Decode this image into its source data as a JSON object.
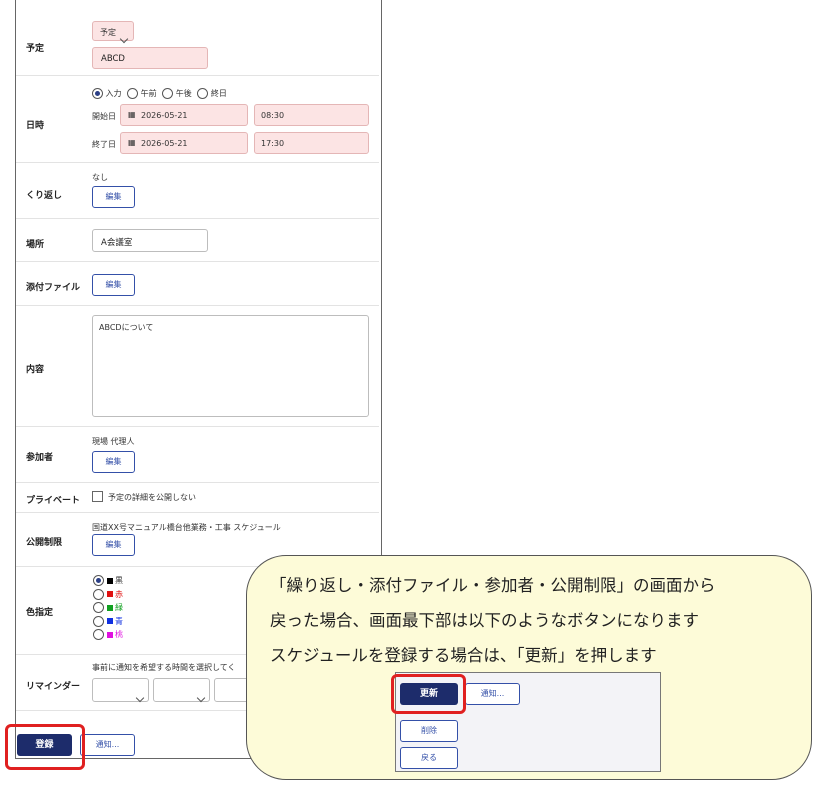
{
  "form": {
    "schedule": {
      "label": "予定",
      "type_select": "予定",
      "title_value": "ABCD"
    },
    "datetime": {
      "label": "日時",
      "options": [
        "入力",
        "午前",
        "午後",
        "終日"
      ],
      "selected": "入力",
      "start_label": "開始日",
      "start_date": "2026-05-21",
      "start_time": "08:30",
      "end_label": "終了日",
      "end_date": "2026-05-21",
      "end_time": "17:30"
    },
    "repeat": {
      "label": "くり返し",
      "value": "なし",
      "edit_label": "編集"
    },
    "place": {
      "label": "場所",
      "value": "A会議室"
    },
    "attachment": {
      "label": "添付ファイル",
      "edit_label": "編集"
    },
    "content": {
      "label": "内容",
      "value": "ABCDについて"
    },
    "participants": {
      "label": "参加者",
      "value": "現場 代理人",
      "edit_label": "編集"
    },
    "private": {
      "label": "プライベート",
      "checkbox_label": "予定の詳細を公開しない"
    },
    "public_limit": {
      "label": "公開制限",
      "value": "国道XX号マニュアル橋台他業務・工事 スケジュール",
      "edit_label": "編集"
    },
    "color": {
      "label": "色指定",
      "options": [
        {
          "name": "黒",
          "color": "#000000"
        },
        {
          "name": "赤",
          "color": "#e01010"
        },
        {
          "name": "緑",
          "color": "#10a020"
        },
        {
          "name": "青",
          "color": "#1030e0"
        },
        {
          "name": "桃",
          "color": "#e010e0"
        }
      ],
      "selected": "黒"
    },
    "reminder": {
      "label": "リマインダー",
      "hint": "事前に通知を希望する時間を選択してく"
    }
  },
  "footer": {
    "register_label": "登録",
    "notify_label": "通知..."
  },
  "callout": {
    "line1": "「繰り返し・添付ファイル・参加者・公開制限」の画面から",
    "line2": "戻った場合、画面最下部は以下のようなボタンになります",
    "line3": "スケジュールを登録する場合は、「更新」を押します"
  },
  "inset": {
    "update_label": "更新",
    "notify_label": "通知...",
    "delete_label": "削除",
    "back_label": "戻る"
  }
}
